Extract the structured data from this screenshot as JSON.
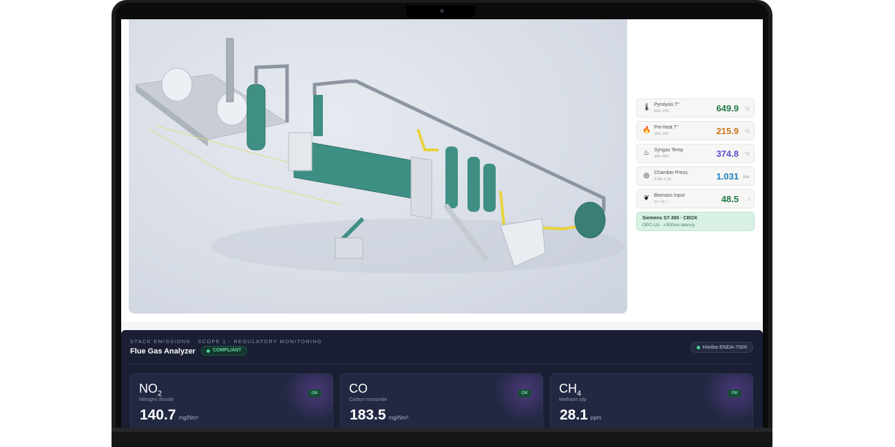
{
  "sensors": [
    {
      "name": "Pyrolysis T°",
      "range": "620–750",
      "value": "649.9",
      "unit": "°C",
      "color": "#1f7a4a",
      "icon": "thermometer-icon",
      "glyph": "🌡"
    },
    {
      "name": "Pre-heat T°",
      "range": "180–260",
      "value": "215.9",
      "unit": "°C",
      "color": "#c9731a",
      "icon": "flame-icon",
      "glyph": "🔥"
    },
    {
      "name": "Syngas Temp",
      "range": "300–450",
      "value": "374.8",
      "unit": "°C",
      "color": "#5b4fcf",
      "icon": "gas-icon",
      "glyph": "♨"
    },
    {
      "name": "Chamber Press.",
      "range": "0.98–1.10",
      "value": "1.031",
      "unit": "bar",
      "color": "#1c7fbf",
      "icon": "gauge-icon",
      "glyph": "◎"
    },
    {
      "name": "Biomass Input",
      "range": "12–16 t",
      "value": "48.5",
      "unit": "t",
      "color": "#1f7a4a",
      "icon": "leaf-icon",
      "glyph": "❦"
    }
  ],
  "plc": {
    "title": "Siemens S7-300 · CBOX",
    "subtitle": "OPC-UA · <300ms latency"
  },
  "emissions": {
    "eyebrow": "STACK EMISSIONS · SCOPE 1 · REGULATORY MONITORING",
    "title": "Flue Gas Analyzer",
    "status": "COMPLIANT",
    "device": "Horiba ENDA-7000",
    "cards": [
      {
        "gas": "NO",
        "gas_sub": "2",
        "name": "Nitrogen dioxide",
        "status": "OK",
        "value": "140.7",
        "unit": "mg/Nm³"
      },
      {
        "gas": "CO",
        "gas_sub": "",
        "name": "Carbon monoxide",
        "status": "OK",
        "value": "183.5",
        "unit": "mg/Nm³"
      },
      {
        "gas": "CH",
        "gas_sub": "4",
        "name": "Methane slip",
        "status": "OK",
        "value": "28.1",
        "unit": "ppm"
      }
    ]
  }
}
